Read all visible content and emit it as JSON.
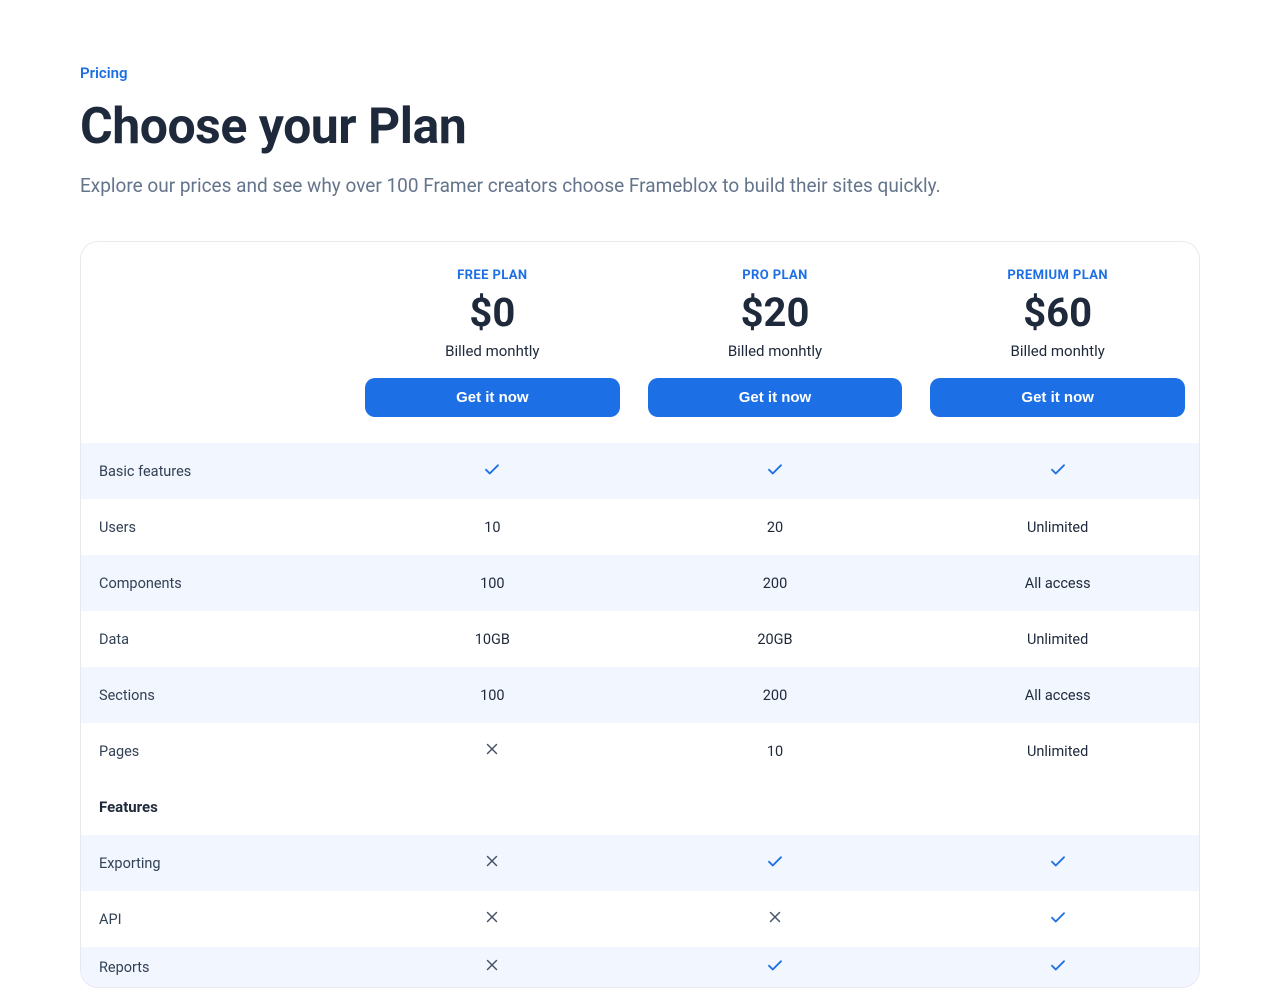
{
  "header": {
    "eyebrow": "Pricing",
    "headline": "Choose your Plan",
    "subhead": "Explore our prices and see why over 100 Framer creators choose Frameblox to build their sites quickly."
  },
  "plans": [
    {
      "id": "free",
      "name": "FREE PLAN",
      "price": "$0",
      "billing": "Billed monhtly",
      "cta": "Get it now"
    },
    {
      "id": "pro",
      "name": "PRO PLAN",
      "price": "$20",
      "billing": "Billed monhtly",
      "cta": "Get it now"
    },
    {
      "id": "premium",
      "name": "PREMIUM PLAN",
      "price": "$60",
      "billing": "Billed monhtly",
      "cta": "Get it now"
    }
  ],
  "rows": [
    {
      "label": "Basic features",
      "alt": true,
      "vals": [
        "check",
        "check",
        "check"
      ]
    },
    {
      "label": "Users",
      "alt": false,
      "vals": [
        "10",
        "20",
        "Unlimited"
      ]
    },
    {
      "label": "Components",
      "alt": true,
      "vals": [
        "100",
        "200",
        "All access"
      ]
    },
    {
      "label": "Data",
      "alt": false,
      "vals": [
        "10GB",
        "20GB",
        "Unlimited"
      ]
    },
    {
      "label": "Sections",
      "alt": true,
      "vals": [
        "100",
        "200",
        "All access"
      ]
    },
    {
      "label": "Pages",
      "alt": false,
      "vals": [
        "cross",
        "10",
        "Unlimited"
      ]
    },
    {
      "label": "Features",
      "section": true
    },
    {
      "label": "Exporting",
      "alt": true,
      "vals": [
        "cross",
        "check",
        "check"
      ]
    },
    {
      "label": "API",
      "alt": false,
      "vals": [
        "cross",
        "cross",
        "check"
      ]
    },
    {
      "label": "Reports",
      "alt": true,
      "vals": [
        "cross",
        "check",
        "check"
      ],
      "partial": true
    }
  ],
  "icons": {
    "check_color": "#1d6fe6",
    "cross_color": "#475569"
  }
}
